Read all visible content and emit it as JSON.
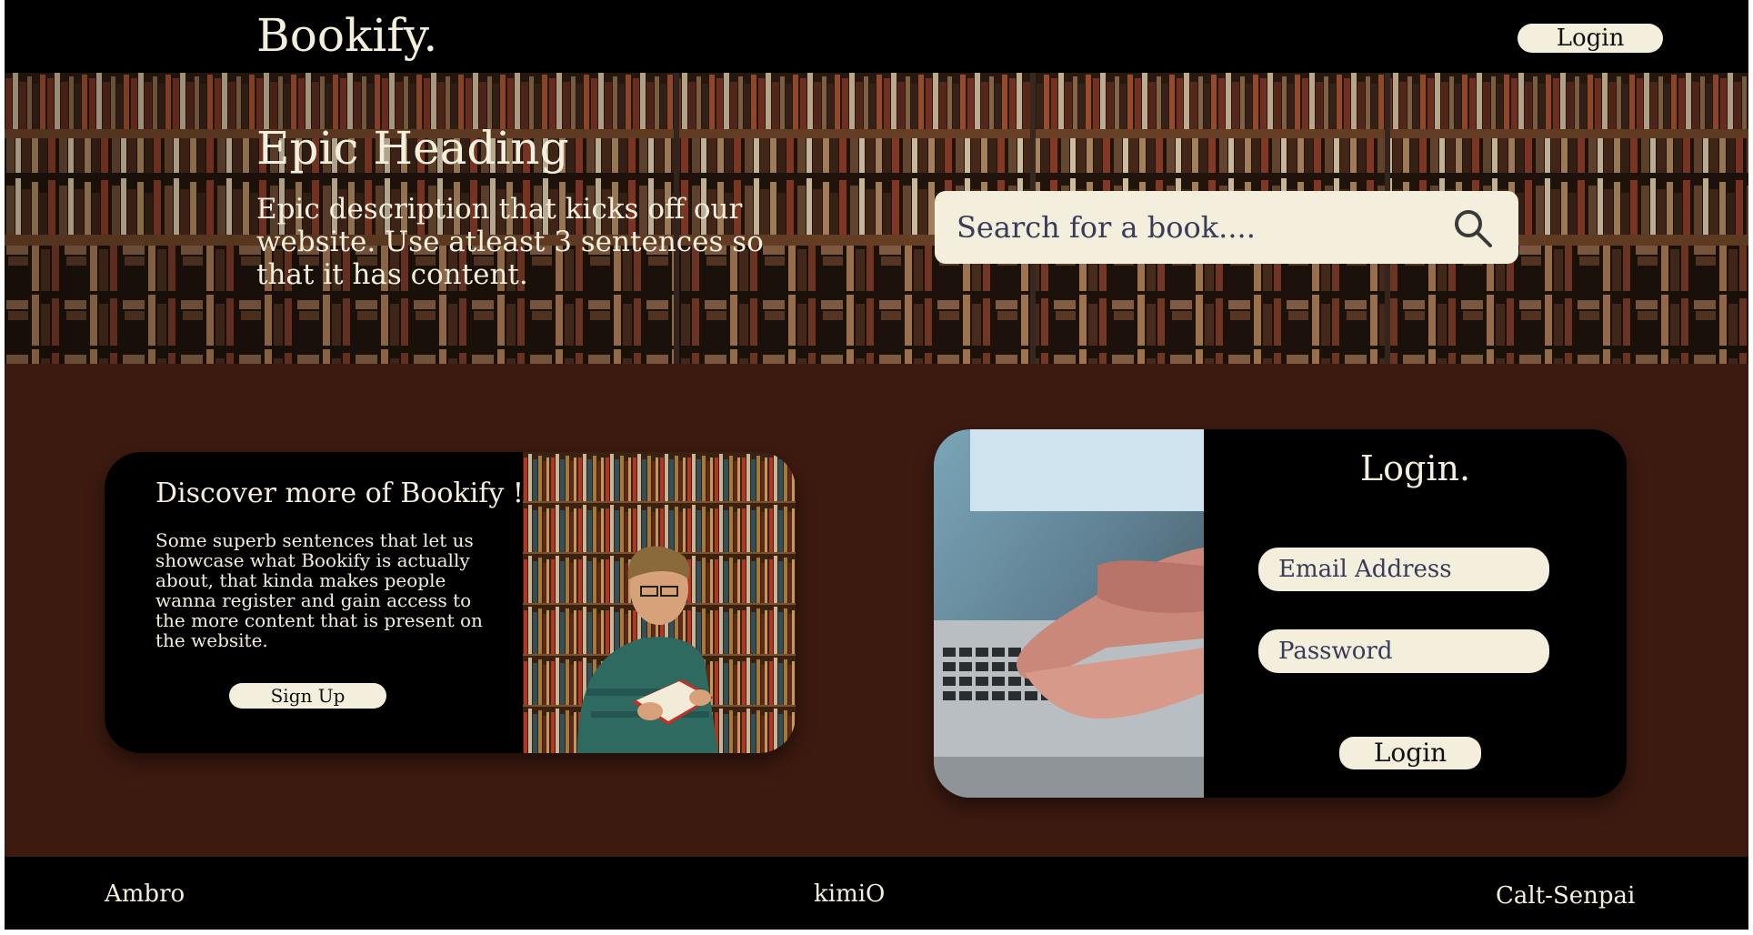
{
  "header": {
    "brand": "Bookify.",
    "login_label": "Login"
  },
  "hero": {
    "title": "Epic Heading",
    "description": "Epic description that kicks off our website. Use atleast 3 sentences so that it has content.",
    "search_placeholder": "Search for a book...."
  },
  "discover": {
    "title": "Discover more of Bookify !",
    "text": "Some superb sentences that let us showcase what Bookify is actually about, that kinda makes people wanna register and gain access to the more content that is present on the website.",
    "signup_label": "Sign Up"
  },
  "login": {
    "title": "Login.",
    "email_placeholder": "Email Address",
    "password_placeholder": "Password",
    "submit_label": "Login"
  },
  "footer": {
    "names": [
      "Ambro",
      "kimiO",
      "Calt-Senpai"
    ]
  },
  "colors": {
    "bar": "#000000",
    "cream": "#f3efdc",
    "brown": "#3d1a10"
  },
  "icons": {
    "search": "search-icon"
  }
}
